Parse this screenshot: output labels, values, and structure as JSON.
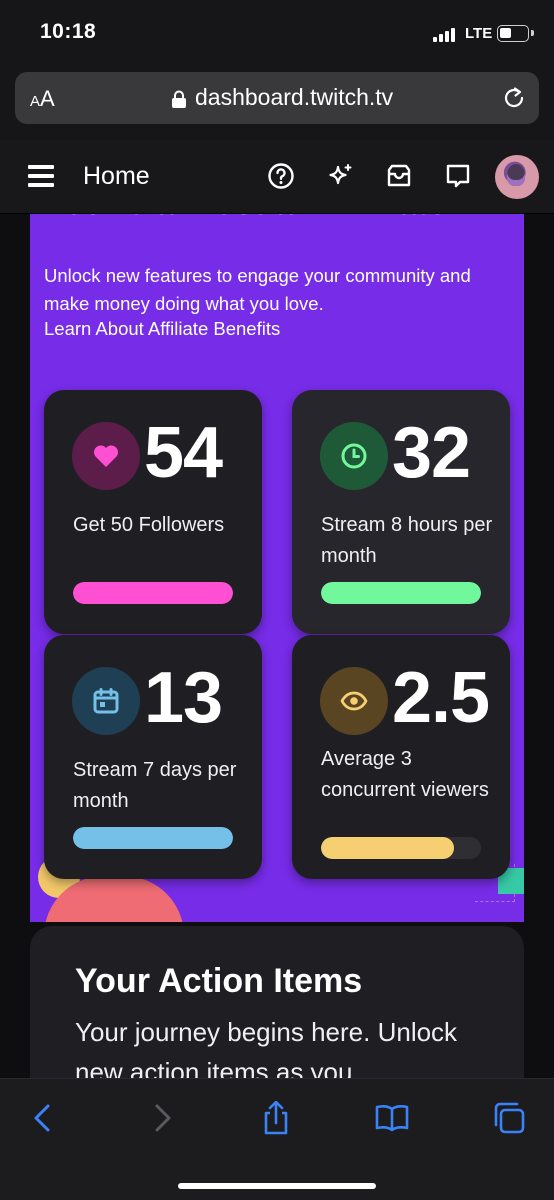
{
  "status_bar": {
    "time": "10:18",
    "network": "LTE"
  },
  "browser": {
    "text_size_small": "A",
    "text_size_large": "A",
    "url": "dashboard.twitch.tv"
  },
  "nav": {
    "title": "Home"
  },
  "affiliate": {
    "heading": "You're almost an Affiliate!",
    "description": "Unlock new features to engage your community and make money doing what you love.",
    "learn_link": "Learn About Affiliate Benefits",
    "stats": [
      {
        "value": "54",
        "label": "Get 50 Followers",
        "icon": "heart-icon",
        "accent": "#ff4fd3",
        "icon_bg": "#5c1d4a",
        "progress": 1.0
      },
      {
        "value": "32",
        "label": "Stream 8 hours per month",
        "icon": "clock-icon",
        "accent": "#71f89c",
        "icon_bg": "#1f5a38",
        "progress": 1.0
      },
      {
        "value": "13",
        "label": "Stream 7 days per month",
        "icon": "calendar-icon",
        "accent": "#74c0e8",
        "icon_bg": "#1f3f55",
        "progress": 1.0
      },
      {
        "value": "2.5",
        "label": "Average 3 concurrent viewers",
        "icon": "eye-icon",
        "accent": "#f7cf73",
        "icon_bg": "#5a4522",
        "progress": 0.83
      }
    ]
  },
  "action_items": {
    "title": "Your Action Items",
    "subtitle": "Your journey begins here. Unlock new action items as you"
  }
}
